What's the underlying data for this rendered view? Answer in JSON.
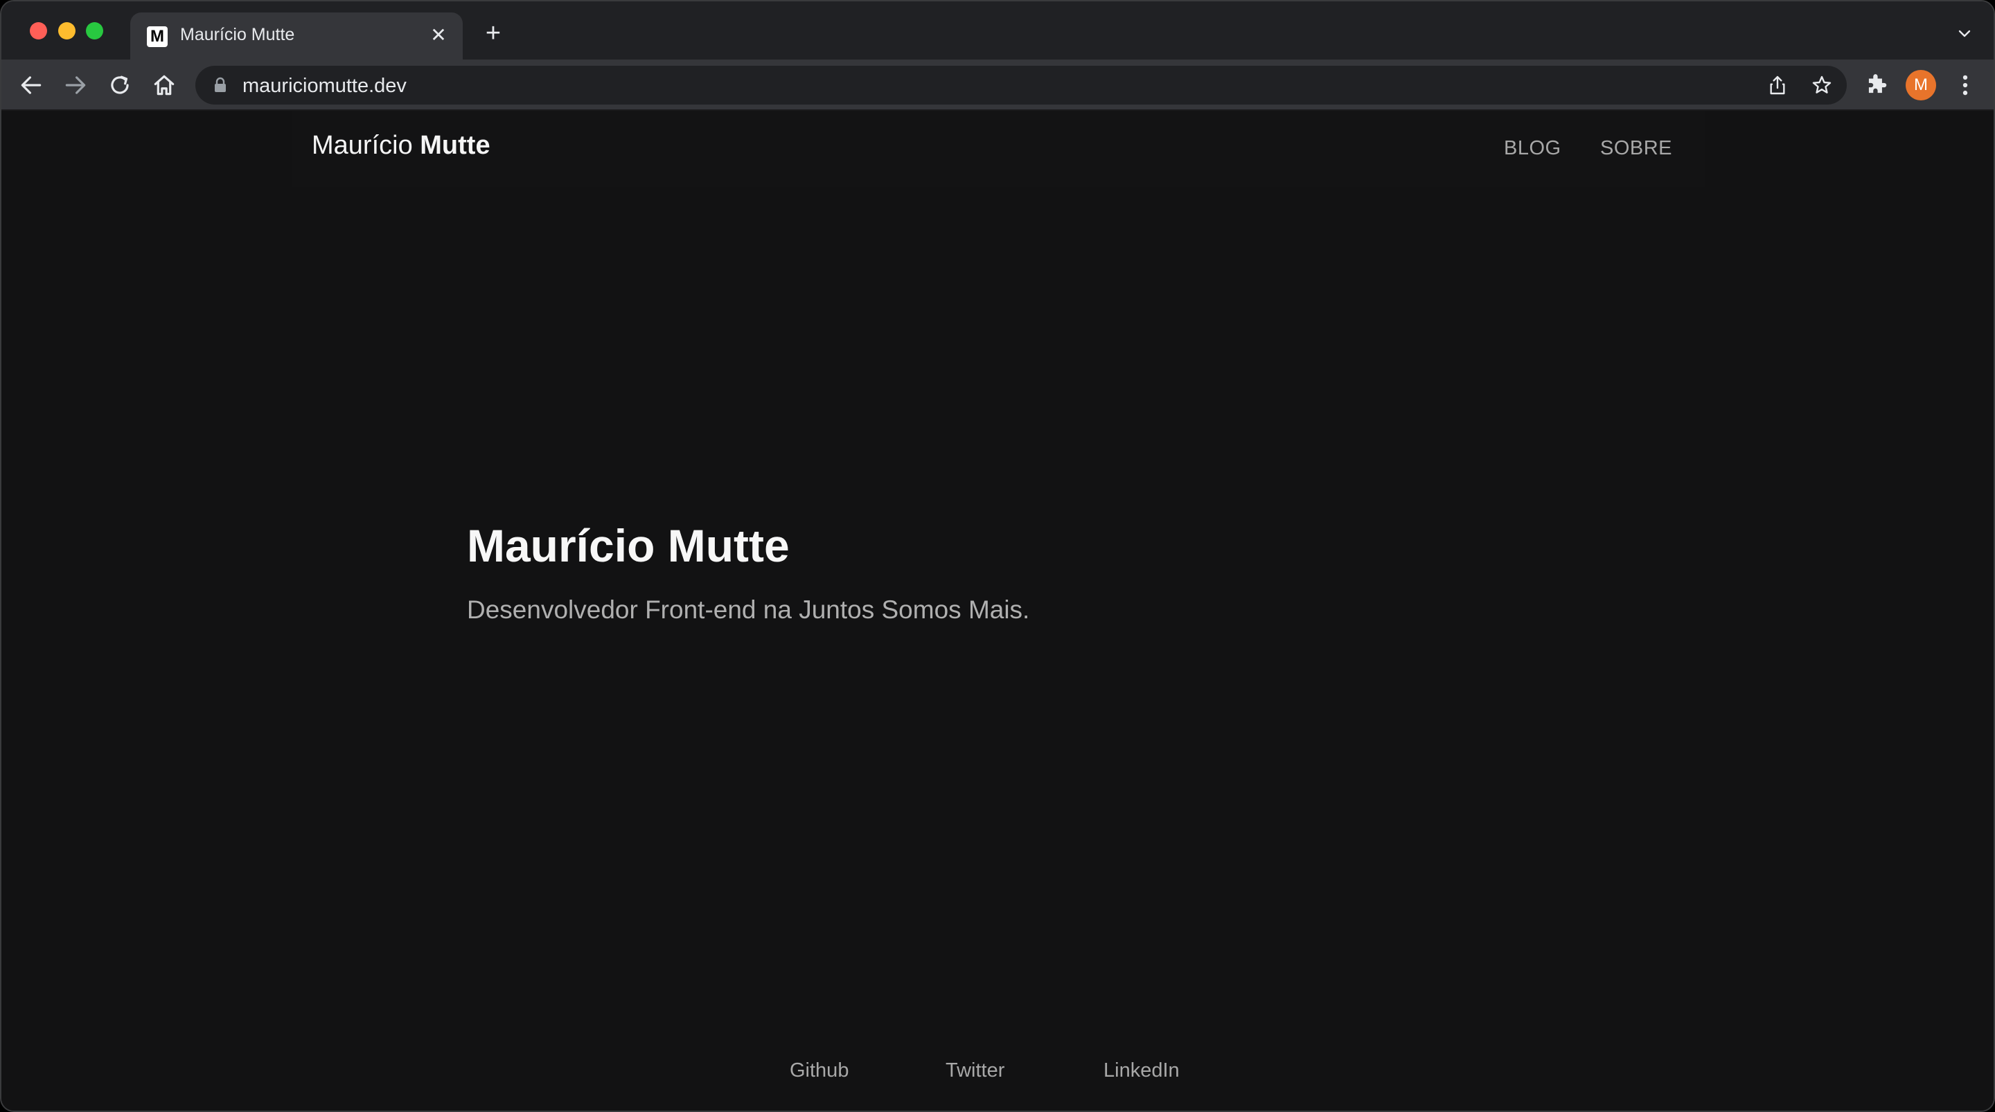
{
  "browser": {
    "tab": {
      "favicon_letter": "M",
      "title": "Maurício Mutte"
    },
    "new_tab_symbol": "+",
    "close_symbol": "✕",
    "address_bar": {
      "url": "mauriciomutte.dev"
    },
    "profile_initial": "M",
    "profile_color": "#e8742b"
  },
  "site": {
    "brand": {
      "first": "Maurício",
      "last": "Mutte"
    },
    "nav": [
      {
        "label": "BLOG"
      },
      {
        "label": "SOBRE"
      }
    ],
    "hero": {
      "title": "Maurício Mutte",
      "subtitle": "Desenvolvedor Front-end na Juntos Somos Mais."
    },
    "footer_links": [
      {
        "label": "Github"
      },
      {
        "label": "Twitter"
      },
      {
        "label": "LinkedIn"
      }
    ]
  },
  "icons": [
    "back-icon",
    "forward-icon",
    "reload-icon",
    "home-icon",
    "lock-icon",
    "share-icon",
    "star-icon",
    "extensions-icon",
    "menu-icon",
    "chevron-down-icon"
  ]
}
